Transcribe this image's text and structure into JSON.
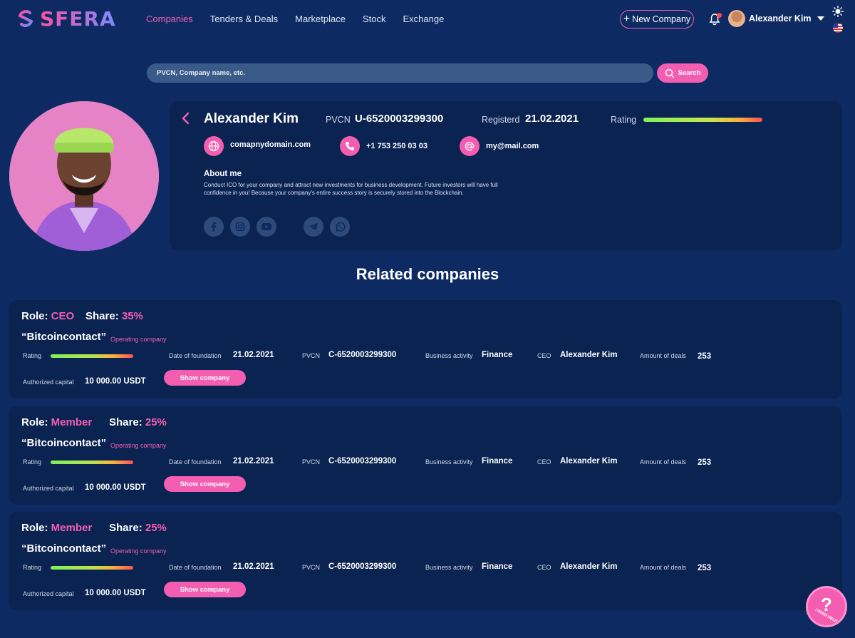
{
  "brand": {
    "name": "SFERA"
  },
  "nav": {
    "items": [
      {
        "label": "Companies",
        "active": true
      },
      {
        "label": "Tenders & Deals",
        "active": false
      },
      {
        "label": "Marketplace",
        "active": false
      },
      {
        "label": "Stock",
        "active": false
      },
      {
        "label": "Exchange",
        "active": false
      }
    ],
    "new_company_label": "New Company",
    "user_name": "Alexander Kim"
  },
  "search": {
    "placeholder": "PVCN, Company name, etc.",
    "button_label": "Search"
  },
  "profile": {
    "name": "Alexander Kim",
    "pvcn_label": "PVCN",
    "pvcn": "U-6520003299300",
    "registered_label": "Registerd",
    "registered": "21.02.2021",
    "rating_label": "Rating",
    "website": "comapnydomain.com",
    "phone": "+1 753 250 03 03",
    "email": "my@mail.com",
    "about_title": "About me",
    "about_text": "Conduct ICO for your company and attract new investments for business development. Future investors will have full confidence in you! Because your company's entire success story is securely stored into the Blockchain."
  },
  "related": {
    "title": "Related companies",
    "labels": {
      "role": "Role:",
      "share": "Share:",
      "rating": "Rating",
      "date_of_foundation": "Date of foundation",
      "pvcn": "PVCN",
      "business_activity": "Business activity",
      "ceo": "CEO",
      "amount_of_deals": "Amount of deals",
      "authorized_capital": "Authorized capital",
      "show_company": "Show company"
    },
    "companies": [
      {
        "role": "CEO",
        "share": "35%",
        "name": "“Bitcoincontact”",
        "type": "Operating company",
        "date": "21.02.2021",
        "pvcn": "C-6520003299300",
        "activity": "Finance",
        "ceo": "Alexander Kim",
        "deals": "253",
        "capital": "10 000.00 USDT"
      },
      {
        "role": "Member",
        "share": "25%",
        "name": "“Bitcoincontact”",
        "type": "Operating company",
        "date": "21.02.2021",
        "pvcn": "C-6520003299300",
        "activity": "Finance",
        "ceo": "Alexander Kim",
        "deals": "253",
        "capital": "10 000.00 USDT"
      },
      {
        "role": "Member",
        "share": "25%",
        "name": "“Bitcoincontact”",
        "type": "Operating company",
        "date": "21.02.2021",
        "pvcn": "C-6520003299300",
        "activity": "Finance",
        "ceo": "Alexander Kim",
        "deals": "253",
        "capital": "10 000.00 USDT"
      }
    ]
  },
  "help": {
    "text": "I NEED HELP"
  },
  "colors": {
    "accent": "#f45eb1",
    "background": "#0d2b62",
    "card": "#0a2351"
  }
}
